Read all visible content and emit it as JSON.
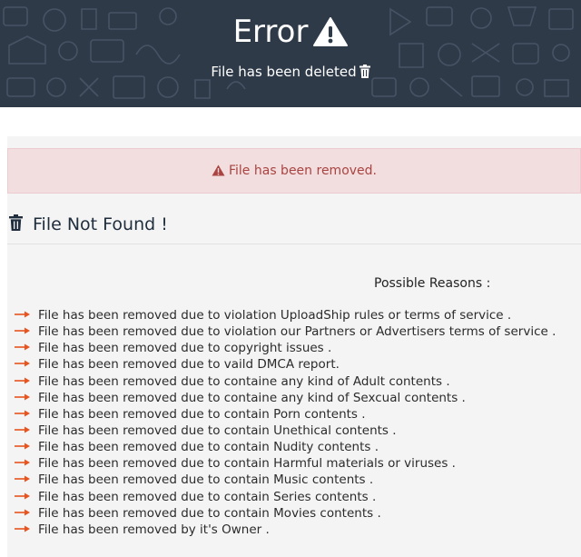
{
  "header": {
    "title": "Error",
    "subtitle": "File has been deleted"
  },
  "alert": {
    "text": "File has been removed."
  },
  "not_found": {
    "title": "File Not Found !"
  },
  "reasons": {
    "title": "Possible Reasons :",
    "items": [
      "File has been removed due to violation UploadShip rules or terms of service .",
      "File has been removed due to violation our Partners or Advertisers terms of service .",
      "File has been removed due to copyright issues .",
      "File has been removed due to vaild DMCA report.",
      "File has been removed due to containe any kind of Adult contents .",
      "File has been removed due to containe any kind of Sexcual contents .",
      "File has been removed due to contain Porn contents .",
      "File has been removed due to contain Unethical contents .",
      "File has been removed due to contain Nudity contents .",
      "File has been removed due to contain Harmful materials or viruses .",
      "File has been removed due to contain Music contents .",
      "File has been removed due to contain Series contents .",
      "File has been removed due to contain Movies contents .",
      "File has been removed by it's Owner ."
    ]
  },
  "colors": {
    "header_bg": "#2f3a49",
    "alert_bg": "#f2dede",
    "alert_text": "#a94442",
    "arrow": "#e8541e",
    "panel_bg": "#f4f4f4"
  },
  "icons": {
    "title": "warning-triangle-icon",
    "subtitle": "trash-icon",
    "alert": "warning-triangle-icon",
    "not_found": "trash-icon",
    "list_bullet": "long-arrow-right-icon"
  }
}
